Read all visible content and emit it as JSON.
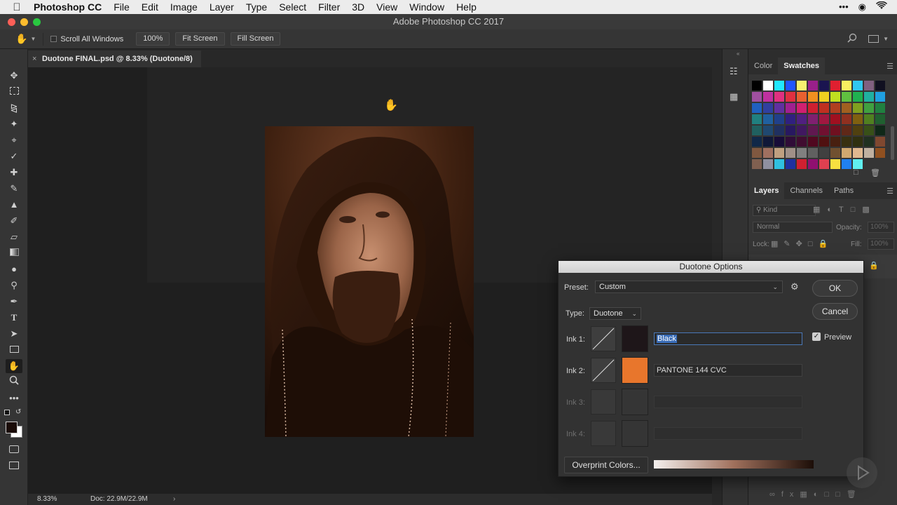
{
  "menubar": {
    "app_name": "Photoshop CC",
    "items": [
      "File",
      "Edit",
      "Image",
      "Layer",
      "Type",
      "Select",
      "Filter",
      "3D",
      "View",
      "Window",
      "Help"
    ]
  },
  "window": {
    "title": "Adobe Photoshop CC 2017"
  },
  "options_bar": {
    "scroll_all_label": "Scroll All Windows",
    "zoom_label": "100%",
    "fit_screen_label": "Fit Screen",
    "fill_screen_label": "Fill Screen"
  },
  "document": {
    "tab_label": "Duotone FINAL.psd @ 8.33% (Duotone/8)",
    "zoom": "8.33%",
    "doc_size": "Doc: 22.9M/22.9M"
  },
  "swatches_panel": {
    "tabs": [
      "Color",
      "Swatches"
    ],
    "active_tab": "Swatches",
    "swatches": [
      "#000000",
      "#ffffff",
      "#22e8ff",
      "#2255ff",
      "#f8f070",
      "#99208a",
      "#1a1450",
      "#e02030",
      "#f8f060",
      "#30c8f0",
      "#806080",
      "#101020",
      "#a050a0",
      "#c030a0",
      "#e03080",
      "#e03040",
      "#e86030",
      "#f09020",
      "#f0d020",
      "#c0e020",
      "#60c040",
      "#20b050",
      "#20b0a0",
      "#20a0e0",
      "#2060c0",
      "#3040a0",
      "#6030a0",
      "#a02090",
      "#d02070",
      "#d02030",
      "#c03020",
      "#b04020",
      "#a06020",
      "#80a020",
      "#40a040",
      "#208040",
      "#208080",
      "#2060a0",
      "#20408a",
      "#302080",
      "#502080",
      "#802070",
      "#a01840",
      "#a01020",
      "#903020",
      "#806010",
      "#508020",
      "#206030",
      "#206060",
      "#204870",
      "#203060",
      "#281860",
      "#401860",
      "#601850",
      "#701030",
      "#701020",
      "#602818",
      "#504010",
      "#385018",
      "#102818",
      "#102848",
      "#101838",
      "#180c38",
      "#300c38",
      "#400c30",
      "#500820",
      "#501010",
      "#482010",
      "#383010",
      "#303010",
      "#203020",
      "#804830",
      "#805840",
      "#a07060",
      "#c0a080",
      "#a09088",
      "#808080",
      "#606060",
      "#404040",
      "#705030",
      "#d0a870",
      "#e0b890",
      "#c0b0a0",
      "#905020",
      "#806050",
      "#9090a0",
      "#30c0e0",
      "#2030a0",
      "#d02030",
      "#901070",
      "#e04050",
      "#f8e040",
      "#2080f0",
      "#60f0f0"
    ]
  },
  "layers_panel": {
    "tabs": [
      "Layers",
      "Channels",
      "Paths"
    ],
    "active_tab": "Layers",
    "filter_label": "Kind",
    "blend_mode": "Normal",
    "opacity_label": "Opacity:",
    "opacity_value": "100%",
    "lock_label": "Lock:",
    "fill_label": "Fill:",
    "fill_value": "100%"
  },
  "dialog": {
    "title": "Duotone Options",
    "preset_label": "Preset:",
    "preset_value": "Custom",
    "type_label": "Type:",
    "type_value": "Duotone",
    "ok_label": "OK",
    "cancel_label": "Cancel",
    "preview_label": "Preview",
    "inks": [
      {
        "label": "Ink 1:",
        "name": "Black",
        "color": "#1e1619",
        "enabled": true
      },
      {
        "label": "Ink 2:",
        "name": "PANTONE 144 CVC",
        "color": "#e8762c",
        "enabled": true
      },
      {
        "label": "Ink 3:",
        "name": "",
        "color": "#353535",
        "enabled": false
      },
      {
        "label": "Ink 4:",
        "name": "",
        "color": "#353535",
        "enabled": false
      }
    ],
    "overprint_label": "Overprint Colors...",
    "gradient_start": "#f4f0ee",
    "gradient_mid": "#a0705c",
    "gradient_end": "#1c0e08"
  },
  "colors": {
    "photo_light": "#b07a58",
    "photo_dark": "#1a0c06"
  }
}
